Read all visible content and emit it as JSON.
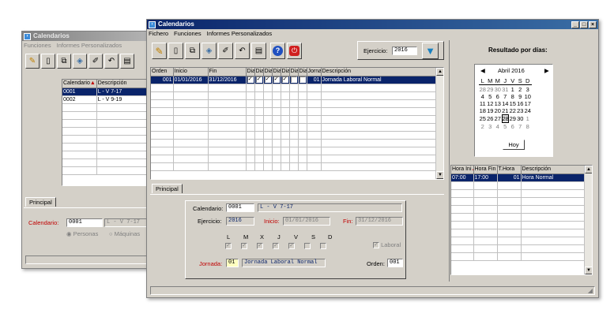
{
  "back_window": {
    "title": "Calendarios",
    "menu": [
      "Funciones",
      "Informes Personalizados"
    ],
    "columns": [
      "Calendario",
      "Descripción"
    ],
    "rows": [
      {
        "code": "0001",
        "desc": "L - V 7-17"
      },
      {
        "code": "0002",
        "desc": "L - V 9-19"
      }
    ],
    "tab": "Principal",
    "calendario_label": "Calendario:",
    "calendario_value": "0001",
    "calendario_desc": "L - V 7-17",
    "radio_personas": "Personas",
    "radio_maquinas": "Máquinas"
  },
  "main_window": {
    "title": "Calendarios",
    "menu": [
      "Fichero",
      "Funciones",
      "Informes Personalizados"
    ],
    "ejercicio_label": "Ejercicio:",
    "ejercicio_value": "2016",
    "grid": {
      "columns": [
        "Orden",
        "Inicio",
        "Fin",
        "Dia",
        "Dia",
        "Dia",
        "Dia",
        "Dia",
        "Dia",
        "Dia",
        "Jornada",
        "Descripción"
      ],
      "rows": [
        {
          "orden": "001",
          "inicio": "01/01/2016",
          "fin": "31/12/2016",
          "checks": [
            true,
            true,
            true,
            true,
            true,
            false,
            false
          ],
          "jornada": "01",
          "desc": "Jornada Laboral Normal"
        }
      ]
    },
    "tab": "Principal",
    "form": {
      "calendario_label": "Calendario:",
      "calendario_value": "0001",
      "calendario_desc": "L - V 7-17",
      "ejercicio_label": "Ejercicio:",
      "ejercicio_value": "2016",
      "inicio_label": "Inicio:",
      "inicio_value": "01/01/2016",
      "fin_label": "Fin:",
      "fin_value": "31/12/2016",
      "days": [
        "L",
        "M",
        "X",
        "J",
        "V",
        "S",
        "D"
      ],
      "day_checks": [
        true,
        true,
        true,
        true,
        true,
        false,
        false
      ],
      "laboral_label": "Laboral",
      "jornada_label": "Jornada:",
      "jornada_value": "01",
      "jornada_desc": "Jornada Laboral Normal",
      "orden_label": "Orden:",
      "orden_value": "001"
    },
    "resultado_title": "Resultado por días:",
    "calendar": {
      "month": "Abril 2016",
      "weekdays": [
        "L",
        "M",
        "M",
        "J",
        "V",
        "S",
        "D"
      ],
      "weeks": [
        [
          "28",
          "29",
          "30",
          "31",
          "1",
          "2",
          "3"
        ],
        [
          "4",
          "5",
          "6",
          "7",
          "8",
          "9",
          "10"
        ],
        [
          "11",
          "12",
          "13",
          "14",
          "15",
          "16",
          "17"
        ],
        [
          "18",
          "19",
          "20",
          "21",
          "22",
          "23",
          "24"
        ],
        [
          "25",
          "26",
          "27",
          "28",
          "29",
          "30",
          "1"
        ],
        [
          "2",
          "3",
          "4",
          "5",
          "6",
          "7",
          "8"
        ]
      ],
      "today_label": "Hoy",
      "selected_day": "28"
    },
    "hours_grid": {
      "columns": [
        "Hora Ini",
        "Hora Fin",
        "T.Hora",
        "Descripción"
      ],
      "rows": [
        {
          "ini": "07:00",
          "fin": "17:00",
          "thora": "01",
          "desc": "Hora Normal"
        }
      ]
    }
  }
}
